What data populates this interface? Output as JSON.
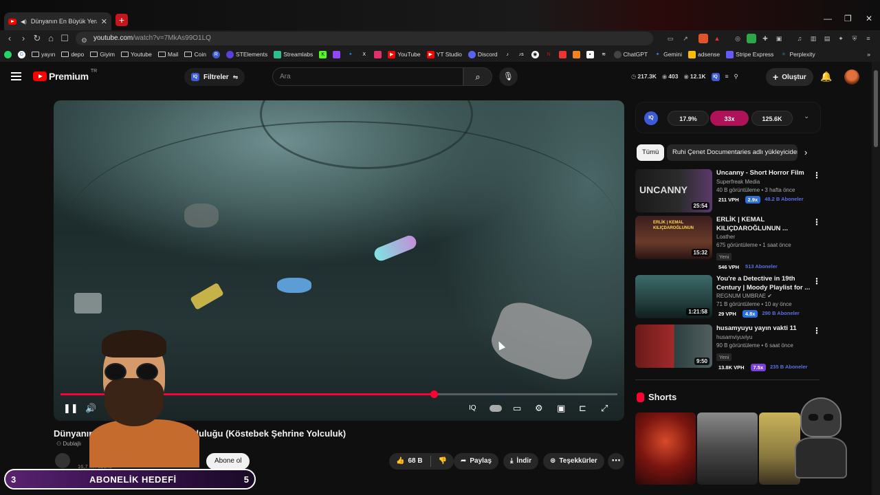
{
  "browser": {
    "tab_title": "Dünyanın En Büyük Yeraltı Toplu",
    "tab_close": "✕",
    "new_tab": "+",
    "url_host": "youtube.com",
    "url_path": "/watch?v=7MkAs99O1LQ",
    "win_min": "—",
    "win_max": "❐",
    "win_close": "✕"
  },
  "bookmarks": [
    {
      "label": "yayın",
      "icon": "folder-icon"
    },
    {
      "label": "depo",
      "icon": "folder-icon"
    },
    {
      "label": "Giyim",
      "icon": "folder-icon"
    },
    {
      "label": "Youtube",
      "icon": "folder-icon"
    },
    {
      "label": "Mail",
      "icon": "folder-icon"
    },
    {
      "label": "Coin",
      "icon": "folder-icon"
    },
    {
      "label": "STElements",
      "icon": "st-icon",
      "color": "#5b3fd9"
    },
    {
      "label": "Streamlabs",
      "icon": "streamlabs-icon",
      "color": "#2fbf8f"
    },
    {
      "label": "YouTube",
      "icon": "youtube-icon",
      "color": "#ff0000"
    },
    {
      "label": "YT Studio",
      "icon": "yt-studio-icon",
      "color": "#ff0000"
    },
    {
      "label": "Discord",
      "icon": "discord-icon",
      "color": "#5865f2"
    },
    {
      "label": "ChatGPT",
      "icon": "chatgpt-icon",
      "color": "#444444"
    },
    {
      "label": "Gemini",
      "icon": "gemini-icon",
      "color": "#4a7cff"
    },
    {
      "label": "adsense",
      "icon": "adsense-icon",
      "color": "#fbbc04"
    },
    {
      "label": "Stripe Express",
      "icon": "stripe-icon",
      "color": "#635bff"
    },
    {
      "label": "Perplexity",
      "icon": "perplexity-icon",
      "color": "#20808d"
    }
  ],
  "header": {
    "logo_text": "Premium",
    "logo_region": "TR",
    "filters_label": "Filtreler",
    "search_placeholder": "Ara",
    "stat_views": "217.3K",
    "stat_likes": "403",
    "stat_subs": "12.1K",
    "create_label": "Oluştur"
  },
  "player": {
    "progress_fraction": 0.67,
    "play_state": "paused-control",
    "title": "Dünyanın En Büyük Yeraltı Topluluğu (Köstebek Şehrine Yolculuk)",
    "title_visible": "Dünyanın En",
    "title_visible_rest": "ltı Topluluğu (Köstebek Şehrine Yolculuk)",
    "dubbed": "Dublajlı",
    "subs_text": "16,7 Mn abone",
    "subscribe_label": "Abone ol",
    "like_count": "68 B",
    "share_label": "Paylaş",
    "download_label": "İndir",
    "thanks_label": "Teşekkürler",
    "more": "⋯"
  },
  "goal": {
    "left": "3",
    "label": "ABONELİK HEDEFİ",
    "right": "5"
  },
  "iq": {
    "logo": "IQ",
    "pct": "17.9%",
    "multiplier": "33x",
    "views": "125.6K"
  },
  "chips": {
    "all": "Tümü",
    "channel": "Ruhi Çenet Documentaries adlı yükleyiciden"
  },
  "recommendations": [
    {
      "title": "Uncanny - Short Horror Film",
      "channel": "Superfreak Media",
      "meta": "40 B görüntüleme • 3 hafta önce",
      "duration": "25:54",
      "badge": "",
      "vph": "211 VPH",
      "mult": "2.9x",
      "mult_color": "#2a6fdc",
      "subs": "48.2 B Aboneler",
      "thumb_text": "UNCANNY"
    },
    {
      "title": "ERLİK | KEMAL KILIÇDAROĞLUNUN ...",
      "channel": "Loather",
      "meta": "675 görüntüleme • 1 saat önce",
      "duration": "15:32",
      "badge": "Yeni",
      "vph": "546 VPH",
      "mult": "",
      "mult_color": "",
      "subs": "513 Aboneler",
      "thumb_text": "ERLİK | KEMAL KILIÇDAROĞLUNUN"
    },
    {
      "title": "You're a Detective in 19th Century | Moody Playlist for ...",
      "channel": "REGNUM UMBRAE",
      "meta": "71 B görüntüleme • 10 ay önce",
      "duration": "1:21:58",
      "badge": "",
      "vph": "29 VPH",
      "mult": "4.8x",
      "mult_color": "#2a6fdc",
      "subs": "290 B Aboneler",
      "thumb_text": ""
    },
    {
      "title": "husamyuyu yayın vakti 11",
      "channel": "husamviyuviyu",
      "meta": "90 B görüntüleme • 6 saat önce",
      "duration": "9:50",
      "badge": "Yeni",
      "vph": "13.8K VPH",
      "mult": "7.5x",
      "mult_color": "#7b3fe0",
      "subs": "235 B Aboneler",
      "thumb_text": ""
    }
  ],
  "shorts": {
    "title": "Shorts"
  }
}
